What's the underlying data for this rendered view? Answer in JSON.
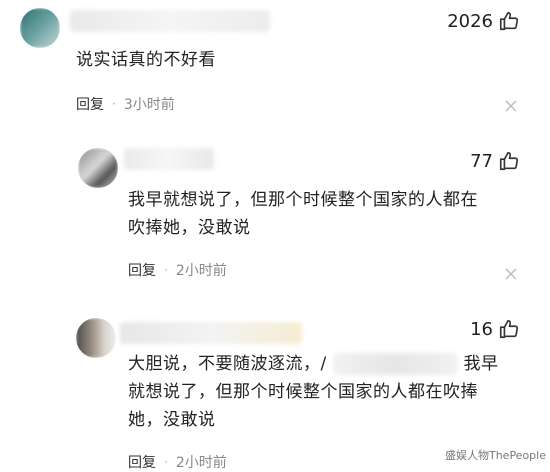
{
  "comments": [
    {
      "likes": "2026",
      "text_lines": [
        "说实话真的不好看"
      ],
      "reply_label": "回复",
      "dot": "·",
      "time": "3小时前"
    },
    {
      "likes": "77",
      "text_lines": [
        "我早就想说了，但那个时候整个国家的人都在",
        "吹捧她，没敢说"
      ],
      "reply_label": "回复",
      "dot": "·",
      "time": "2小时前"
    },
    {
      "likes": "16",
      "text_lines": [
        "大胆说，不要随波逐流，/ ",
        "就想说了，但那个时候整个国家的人都在吹捧",
        "她，没敢说"
      ],
      "line1_suffix": "我早",
      "reply_label": "回复",
      "dot": "·",
      "time": "2小时前"
    }
  ],
  "watermark": "盛娱人物ThePeople",
  "icons": [
    "thumbs-up-icon",
    "close-icon"
  ]
}
